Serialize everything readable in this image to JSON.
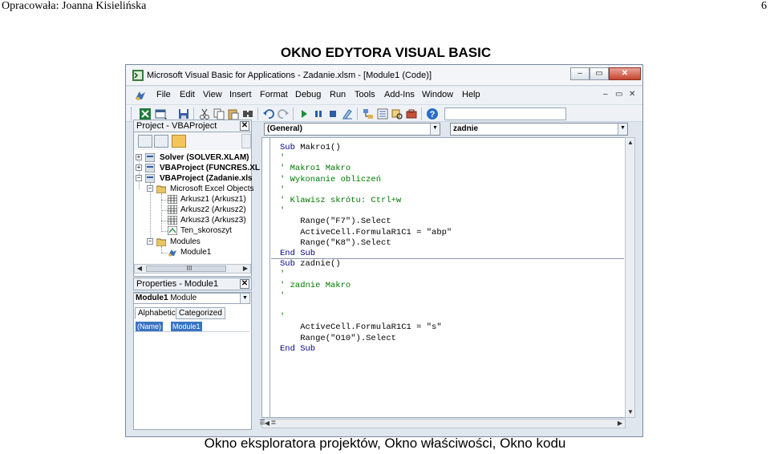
{
  "doc": {
    "header_left": "Opracowała: Joanna Kisielińska",
    "page_number": "6",
    "heading": "OKNO EDYTORA VISUAL BASIC",
    "caption": "Okno eksploratora projektów, Okno właściwości, Okno kodu"
  },
  "window": {
    "title": "Microsoft Visual Basic for Applications - Zadanie.xlsm - [Module1 (Code)]",
    "caption_buttons": {
      "minimize": "–",
      "restore": "▭",
      "close": "✕"
    }
  },
  "menu": {
    "items": [
      {
        "label": "File"
      },
      {
        "label": "Edit"
      },
      {
        "label": "View"
      },
      {
        "label": "Insert"
      },
      {
        "label": "Format"
      },
      {
        "label": "Debug"
      },
      {
        "label": "Run"
      },
      {
        "label": "Tools"
      },
      {
        "label": "Add-Ins"
      },
      {
        "label": "Window"
      },
      {
        "label": "Help"
      }
    ],
    "mdi_controls": {
      "minimize": "–",
      "restore": "▭",
      "close": "✕"
    }
  },
  "toolbar": {
    "icons": [
      "excel-icon",
      "insert-userform-icon",
      "save-icon",
      "cut-icon",
      "copy-icon",
      "paste-icon",
      "find-icon",
      "undo-icon",
      "redo-icon",
      "run-icon",
      "break-icon",
      "reset-icon",
      "design-mode-icon",
      "project-explorer-icon",
      "properties-icon",
      "object-browser-icon",
      "toolbox-icon",
      "help-icon"
    ]
  },
  "project_pane": {
    "title": "Project - VBAProject",
    "close": "✕",
    "tree": [
      {
        "label": "Solver (SOLVER.XLAM)",
        "bold": true
      },
      {
        "label": "VBAProject (FUNCRES.XL",
        "bold": true
      },
      {
        "label": "VBAProject (Zadanie.xls",
        "bold": true
      },
      {
        "label": "Microsoft Excel Objects",
        "bold": false
      },
      {
        "label": "Arkusz1 (Arkusz1)",
        "bold": false
      },
      {
        "label": "Arkusz2 (Arkusz2)",
        "bold": false
      },
      {
        "label": "Arkusz3 (Arkusz3)",
        "bold": false
      },
      {
        "label": "Ten_skoroszyt",
        "bold": false
      },
      {
        "label": "Modules",
        "bold": false
      },
      {
        "label": "Module1",
        "bold": false
      }
    ],
    "hscroll_grip": "III"
  },
  "properties_pane": {
    "title": "Properties - Module1",
    "close": "✕",
    "object_combo": {
      "name": "Module1",
      "type": "Module"
    },
    "tabs": [
      {
        "label": "Alphabetic"
      },
      {
        "label": "Categorized"
      }
    ],
    "rows": [
      {
        "key": "(Name)",
        "value": "Module1"
      }
    ]
  },
  "code_pane": {
    "object_combo": "(General)",
    "procedure_combo": "zadnie",
    "lines": [
      {
        "text": "Sub Makro1()",
        "kind": "code"
      },
      {
        "text": "'",
        "kind": "comment"
      },
      {
        "text": "' Makro1 Makro",
        "kind": "comment"
      },
      {
        "text": "' Wykonanie obliczeń",
        "kind": "comment"
      },
      {
        "text": "'",
        "kind": "comment"
      },
      {
        "text": "' Klawisz skrótu: Ctrl+w",
        "kind": "comment"
      },
      {
        "text": "'",
        "kind": "comment"
      },
      {
        "text": "    Range(\"F7\").Select",
        "kind": "code"
      },
      {
        "text": "    ActiveCell.FormulaR1C1 = \"abp\"",
        "kind": "code"
      },
      {
        "text": "    Range(\"K8\").Select",
        "kind": "code"
      },
      {
        "text": "End Sub",
        "kind": "code"
      },
      {
        "text": "Sub zadnie()",
        "kind": "code"
      },
      {
        "text": "'",
        "kind": "comment"
      },
      {
        "text": "' zadnie Makro",
        "kind": "comment"
      },
      {
        "text": "'",
        "kind": "comment"
      },
      {
        "text": "",
        "kind": "blank"
      },
      {
        "text": "'",
        "kind": "comment"
      },
      {
        "text": "    ActiveCell.FormulaR1C1 = \"s\"",
        "kind": "code"
      },
      {
        "text": "    Range(\"O10\").Select",
        "kind": "code"
      },
      {
        "text": "End Sub",
        "kind": "code"
      }
    ]
  }
}
